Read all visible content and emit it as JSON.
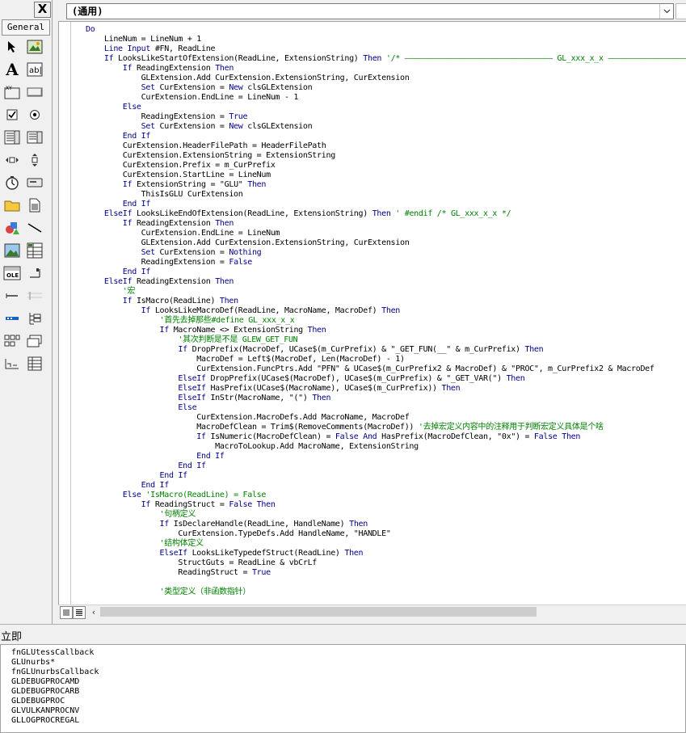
{
  "toolbox": {
    "close_label": "X",
    "tab_label": "General",
    "tools": [
      {
        "icon": "pointer-icon"
      },
      {
        "icon": "picture-icon"
      },
      {
        "icon": "label-icon",
        "glyph": "A"
      },
      {
        "icon": "textbox-icon",
        "glyph": "ab|"
      },
      {
        "icon": "frame-icon"
      },
      {
        "icon": "command-button-icon"
      },
      {
        "icon": "checkbox-icon"
      },
      {
        "icon": "option-button-icon"
      },
      {
        "icon": "combobox-icon"
      },
      {
        "icon": "listbox-icon"
      },
      {
        "icon": "hscrollbar-icon"
      },
      {
        "icon": "vscrollbar-icon"
      },
      {
        "icon": "timer-icon"
      },
      {
        "icon": "drive-listbox-icon"
      },
      {
        "icon": "dir-listbox-icon"
      },
      {
        "icon": "file-listbox-icon"
      },
      {
        "icon": "shape-icon"
      },
      {
        "icon": "line-icon"
      },
      {
        "icon": "image-icon"
      },
      {
        "icon": "data-icon"
      },
      {
        "icon": "ole-icon",
        "glyph": "OLE"
      },
      {
        "icon": "custom-control-1-icon"
      },
      {
        "icon": "custom-control-2-icon"
      },
      {
        "icon": "custom-control-3-icon"
      },
      {
        "icon": "custom-control-4-icon"
      },
      {
        "icon": "treeview-icon"
      },
      {
        "icon": "custom-control-5-icon"
      },
      {
        "icon": "custom-control-6-icon"
      },
      {
        "icon": "custom-control-7-icon"
      },
      {
        "icon": "custom-control-8-icon"
      }
    ]
  },
  "code_window": {
    "proc_combo_value": "(通用)",
    "lines": [
      [
        {
          "t": "Do",
          "k": "kw"
        }
      ],
      [
        {
          "t": "    LineNum = LineNum + 1"
        }
      ],
      [
        {
          "t": "    Line Input",
          "k": "kw"
        },
        {
          "t": " #FN, ReadLine"
        }
      ],
      [
        {
          "t": "    If",
          "k": "kw"
        },
        {
          "t": " LooksLikeStartOfExtension(ReadLine, ExtensionString) "
        },
        {
          "t": "Then",
          "k": "kw"
        },
        {
          "t": " '/* ———————————————————————————————— GL_xxx_x_x ———————————————————————",
          "k": "cm"
        }
      ],
      [
        {
          "t": "        If",
          "k": "kw"
        },
        {
          "t": " ReadingExtension "
        },
        {
          "t": "Then",
          "k": "kw"
        }
      ],
      [
        {
          "t": "            GLExtension.Add CurExtension.ExtensionString, CurExtension"
        }
      ],
      [
        {
          "t": "            Set",
          "k": "kw"
        },
        {
          "t": " CurExtension = "
        },
        {
          "t": "New",
          "k": "kw"
        },
        {
          "t": " clsGLExtension"
        }
      ],
      [
        {
          "t": "            CurExtension.EndLine = LineNum - 1"
        }
      ],
      [
        {
          "t": "        Else",
          "k": "kw"
        }
      ],
      [
        {
          "t": "            ReadingExtension = "
        },
        {
          "t": "True",
          "k": "kw"
        }
      ],
      [
        {
          "t": "            Set",
          "k": "kw"
        },
        {
          "t": " CurExtension = "
        },
        {
          "t": "New",
          "k": "kw"
        },
        {
          "t": " clsGLExtension"
        }
      ],
      [
        {
          "t": "        End If",
          "k": "kw"
        }
      ],
      [
        {
          "t": "        CurExtension.HeaderFilePath = HeaderFilePath"
        }
      ],
      [
        {
          "t": "        CurExtension.ExtensionString = ExtensionString"
        }
      ],
      [
        {
          "t": "        CurExtension.Prefix = m_CurPrefix"
        }
      ],
      [
        {
          "t": "        CurExtension.StartLine = LineNum"
        }
      ],
      [
        {
          "t": "        If",
          "k": "kw"
        },
        {
          "t": " ExtensionString = \"GLU\" "
        },
        {
          "t": "Then",
          "k": "kw"
        }
      ],
      [
        {
          "t": "            ThisIsGLU CurExtension"
        }
      ],
      [
        {
          "t": "        End If",
          "k": "kw"
        }
      ],
      [
        {
          "t": "    ElseIf",
          "k": "kw"
        },
        {
          "t": " LooksLikeEndOfExtension(ReadLine, ExtensionString) "
        },
        {
          "t": "Then",
          "k": "kw"
        },
        {
          "t": " ' #endif /* GL_xxx_x_x */",
          "k": "cm"
        }
      ],
      [
        {
          "t": "        If",
          "k": "kw"
        },
        {
          "t": " ReadingExtension "
        },
        {
          "t": "Then",
          "k": "kw"
        }
      ],
      [
        {
          "t": "            CurExtension.EndLine = LineNum"
        }
      ],
      [
        {
          "t": "            GLExtension.Add CurExtension.ExtensionString, CurExtension"
        }
      ],
      [
        {
          "t": "            Set",
          "k": "kw"
        },
        {
          "t": " CurExtension = "
        },
        {
          "t": "Nothing",
          "k": "kw"
        }
      ],
      [
        {
          "t": "            ReadingExtension = "
        },
        {
          "t": "False",
          "k": "kw"
        }
      ],
      [
        {
          "t": "        End If",
          "k": "kw"
        }
      ],
      [
        {
          "t": "    ElseIf",
          "k": "kw"
        },
        {
          "t": " ReadingExtension "
        },
        {
          "t": "Then",
          "k": "kw"
        }
      ],
      [
        {
          "t": "        '宏",
          "k": "cm"
        }
      ],
      [
        {
          "t": "        If",
          "k": "kw"
        },
        {
          "t": " IsMacro(ReadLine) "
        },
        {
          "t": "Then",
          "k": "kw"
        }
      ],
      [
        {
          "t": "            If",
          "k": "kw"
        },
        {
          "t": " LooksLikeMacroDef(ReadLine, MacroName, MacroDef) "
        },
        {
          "t": "Then",
          "k": "kw"
        }
      ],
      [
        {
          "t": "                '首先去掉那些#define GL_xxx_x_x",
          "k": "cm"
        }
      ],
      [
        {
          "t": "                If",
          "k": "kw"
        },
        {
          "t": " MacroName <> ExtensionString "
        },
        {
          "t": "Then",
          "k": "kw"
        }
      ],
      [
        {
          "t": "                    '其次判断是不是 GLEW_GET_FUN",
          "k": "cm"
        }
      ],
      [
        {
          "t": "                    If",
          "k": "kw"
        },
        {
          "t": " DropPrefix(MacroDef, UCase$(m_CurPrefix) & \"_GET_FUN(__\" & m_CurPrefix) "
        },
        {
          "t": "Then",
          "k": "kw"
        }
      ],
      [
        {
          "t": "                        MacroDef = Left$(MacroDef, Len(MacroDef) - 1)"
        }
      ],
      [
        {
          "t": "                        CurExtension.FuncPtrs.Add \"PFN\" & UCase$(m_CurPrefix2 & MacroDef) & \"PROC\", m_CurPrefix2 & MacroDef"
        }
      ],
      [
        {
          "t": "                    ElseIf",
          "k": "kw"
        },
        {
          "t": " DropPrefix(UCase$(MacroDef), UCase$(m_CurPrefix) & \"_GET_VAR(\") "
        },
        {
          "t": "Then",
          "k": "kw"
        }
      ],
      [
        {
          "t": "                    ElseIf",
          "k": "kw"
        },
        {
          "t": " HasPrefix(UCase$(MacroName), UCase$(m_CurPrefix)) "
        },
        {
          "t": "Then",
          "k": "kw"
        }
      ],
      [
        {
          "t": "                    ElseIf",
          "k": "kw"
        },
        {
          "t": " InStr(MacroName, \"(\") "
        },
        {
          "t": "Then",
          "k": "kw"
        }
      ],
      [
        {
          "t": "                    Else",
          "k": "kw"
        }
      ],
      [
        {
          "t": "                        CurExtension.MacroDefs.Add MacroName, MacroDef"
        }
      ],
      [
        {
          "t": "                        MacroDefClean = Trim$(RemoveComments(MacroDef)) "
        },
        {
          "t": "'去掉宏定义内容中的注释用于判断宏定义具体是个啥",
          "k": "cm"
        }
      ],
      [
        {
          "t": "                        If",
          "k": "kw"
        },
        {
          "t": " IsNumeric(MacroDefClean) = "
        },
        {
          "t": "False And",
          "k": "kw"
        },
        {
          "t": " HasPrefix(MacroDefClean, \"0x\") = "
        },
        {
          "t": "False Then",
          "k": "kw"
        }
      ],
      [
        {
          "t": "                            MacroToLookup.Add MacroName, ExtensionString"
        }
      ],
      [
        {
          "t": "                        End If",
          "k": "kw"
        }
      ],
      [
        {
          "t": "                    End If",
          "k": "kw"
        }
      ],
      [
        {
          "t": "                End If",
          "k": "kw"
        }
      ],
      [
        {
          "t": "            End If",
          "k": "kw"
        }
      ],
      [
        {
          "t": "        Else",
          "k": "kw"
        },
        {
          "t": " 'IsMacro(ReadLine) = False",
          "k": "cm"
        }
      ],
      [
        {
          "t": "            If",
          "k": "kw"
        },
        {
          "t": " ReadingStruct = "
        },
        {
          "t": "False Then",
          "k": "kw"
        }
      ],
      [
        {
          "t": "                '句柄定义",
          "k": "cm"
        }
      ],
      [
        {
          "t": "                If",
          "k": "kw"
        },
        {
          "t": " IsDeclareHandle(ReadLine, HandleName) "
        },
        {
          "t": "Then",
          "k": "kw"
        }
      ],
      [
        {
          "t": "                    CurExtension.TypeDefs.Add HandleName, \"HANDLE\""
        }
      ],
      [
        {
          "t": "                '结构体定义",
          "k": "cm"
        }
      ],
      [
        {
          "t": "                ElseIf",
          "k": "kw"
        },
        {
          "t": " LooksLikeTypedefStruct(ReadLine) "
        },
        {
          "t": "Then",
          "k": "kw"
        }
      ],
      [
        {
          "t": "                    StructGuts = ReadLine & vbCrLf"
        }
      ],
      [
        {
          "t": "                    ReadingStruct = "
        },
        {
          "t": "True",
          "k": "kw"
        }
      ],
      [
        {
          "t": ""
        }
      ],
      [
        {
          "t": "                '类型定义（非函数指针）",
          "k": "cm"
        }
      ]
    ]
  },
  "immediate": {
    "title": "立即",
    "lines": [
      "fnGLUtessCallback",
      "GLUnurbs*",
      "fnGLUnurbsCallback",
      "GLDEBUGPROCAMD",
      "GLDEBUGPROCARB",
      "GLDEBUGPROC",
      "GLVULKANPROCNV",
      "GLLOGPROCREGAL"
    ]
  },
  "colors": {
    "keyword": "#00008b",
    "comment": "#008000",
    "text": "#000000"
  }
}
